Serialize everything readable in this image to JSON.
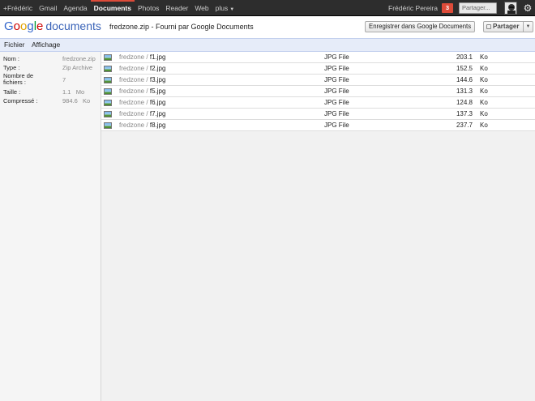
{
  "topbar": {
    "nav": [
      {
        "label": "+Frédéric",
        "active": false
      },
      {
        "label": "Gmail",
        "active": false
      },
      {
        "label": "Agenda",
        "active": false
      },
      {
        "label": "Documents",
        "active": true
      },
      {
        "label": "Photos",
        "active": false
      },
      {
        "label": "Reader",
        "active": false
      },
      {
        "label": "Web",
        "active": false
      },
      {
        "label": "plus",
        "active": false
      }
    ],
    "user_name": "Frédéric Pereira",
    "notification_count": "3",
    "share_placeholder": "Partager...",
    "accent_color": "#dd4b39"
  },
  "header": {
    "logo_google": "Google",
    "logo_product": "documents",
    "doc_title": "fredzone.zip - Fourni par Google Documents",
    "save_button": "Enregistrer dans Google Documents",
    "share_button": "Partager"
  },
  "menubar": {
    "file": "Fichier",
    "view": "Affichage"
  },
  "properties": {
    "name_label": "Nom :",
    "name_value": "fredzone.zip",
    "type_label": "Type :",
    "type_value": "Zip Archive",
    "count_label": "Nombre de fichiers :",
    "count_value": "7",
    "size_label": "Taille :",
    "size_value": "1.1",
    "size_unit": "Mo",
    "compressed_label": "Compressé :",
    "compressed_value": "984.6",
    "compressed_unit": "Ko"
  },
  "files": [
    {
      "folder": "fredzone",
      "sep": "/",
      "name": "f1.jpg",
      "type": "JPG File",
      "size": "203.1",
      "unit": "Ko"
    },
    {
      "folder": "fredzone",
      "sep": "/",
      "name": "f2.jpg",
      "type": "JPG File",
      "size": "152.5",
      "unit": "Ko"
    },
    {
      "folder": "fredzone",
      "sep": "/",
      "name": "f3.jpg",
      "type": "JPG File",
      "size": "144.6",
      "unit": "Ko"
    },
    {
      "folder": "fredzone",
      "sep": "/",
      "name": "f5.jpg",
      "type": "JPG File",
      "size": "131.3",
      "unit": "Ko"
    },
    {
      "folder": "fredzone",
      "sep": "/",
      "name": "f6.jpg",
      "type": "JPG File",
      "size": "124.8",
      "unit": "Ko"
    },
    {
      "folder": "fredzone",
      "sep": "/",
      "name": "f7.jpg",
      "type": "JPG File",
      "size": "137.3",
      "unit": "Ko"
    },
    {
      "folder": "fredzone",
      "sep": "/",
      "name": "f8.jpg",
      "type": "JPG File",
      "size": "237.7",
      "unit": "Ko"
    }
  ],
  "icons": {
    "gear": "gear-icon",
    "avatar": "avatar",
    "thumb": "image-file-icon",
    "dropdown": "chevron-down-icon"
  }
}
